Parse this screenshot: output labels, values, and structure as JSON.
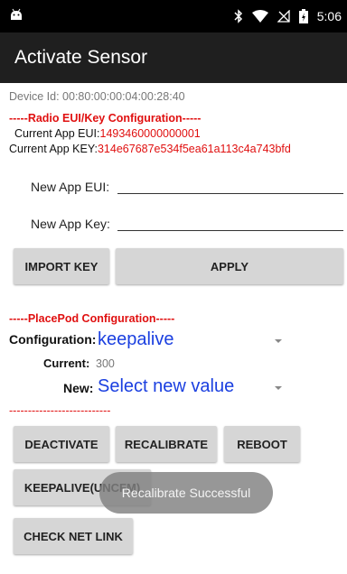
{
  "status_bar": {
    "time": "5:06",
    "icons": [
      "android-icon",
      "bluetooth-icon",
      "wifi-icon",
      "no-signal-icon",
      "battery-icon"
    ]
  },
  "app_bar": {
    "title": "Activate Sensor"
  },
  "device": {
    "id_text": "Device Id: 00:80:00:00:04:00:28:40"
  },
  "radio": {
    "heading": "-----Radio EUI/Key Configuration-----",
    "current_eui_label": "Current App EUI:",
    "current_eui_value": "1493460000000001",
    "current_key_label": "Current App KEY:",
    "current_key_value": "314e67687e534f5ea61a113c4a743bfd",
    "new_eui_label": "New App EUI:",
    "new_eui_value": "",
    "new_key_label": "New App Key:",
    "new_key_value": "",
    "import_key_label": "IMPORT KEY",
    "apply_label": "APPLY"
  },
  "placepod": {
    "heading": "-----PlacePod Configuration-----",
    "configuration_label": "Configuration:",
    "configuration_value": "keepalive",
    "current_label": "Current:",
    "current_value": "300",
    "new_label": "New:",
    "new_value": "Select new value",
    "divider": "---------------------------"
  },
  "actions": {
    "deactivate": "DEACTIVATE",
    "recalibrate": "RECALIBRATE",
    "reboot": "REBOOT",
    "keepalive": "KEEPALIVE(UNCFM)",
    "check_net_link": "CHECK NET LINK"
  },
  "toast": {
    "message": "Recalibrate Successful"
  },
  "colors": {
    "accent_red": "#e01010",
    "spinner_blue": "#1a3fe0",
    "button_gray": "#d6d6d6",
    "app_bar": "#1f1f1f"
  }
}
